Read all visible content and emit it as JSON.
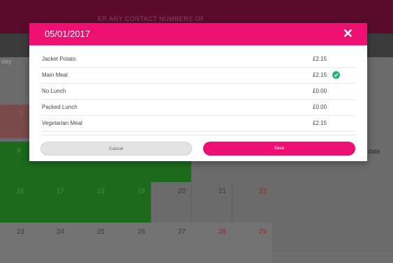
{
  "background": {
    "header_text": "ER ANY CONTACT NUMBERS OF",
    "day_label": "day",
    "date_label": "date",
    "side_number": "2",
    "calendar": [
      {
        "num": "9",
        "style": "green",
        "red": false
      },
      {
        "num": "",
        "style": "green",
        "red": false
      },
      {
        "num": "",
        "style": "green",
        "red": false
      },
      {
        "num": "",
        "style": "green",
        "red": false
      },
      {
        "num": "",
        "style": "green",
        "red": false
      },
      {
        "num": "16",
        "style": "green",
        "red": false
      },
      {
        "num": "17",
        "style": "green",
        "red": false
      },
      {
        "num": "18",
        "style": "green",
        "red": false
      },
      {
        "num": "19",
        "style": "green",
        "red": false
      },
      {
        "num": "20",
        "style": "gray",
        "red": false
      },
      {
        "num": "21",
        "style": "gray",
        "red": false
      },
      {
        "num": "22",
        "style": "gray",
        "red": true
      },
      {
        "num": "23",
        "style": "lightgray",
        "red": false
      },
      {
        "num": "24",
        "style": "lightgray",
        "red": false
      },
      {
        "num": "25",
        "style": "lightgray",
        "red": false
      },
      {
        "num": "26",
        "style": "lightgray",
        "red": false
      },
      {
        "num": "27",
        "style": "lightgray",
        "red": false
      },
      {
        "num": "28",
        "style": "lightgray",
        "red": true
      },
      {
        "num": "29",
        "style": "lightgray",
        "red": true
      }
    ]
  },
  "modal": {
    "title": "05/01/2017",
    "close_icon": "close-icon",
    "meals": [
      {
        "name": "Jacket Potato",
        "price": "£2.15",
        "selected": false
      },
      {
        "name": "Main Meal",
        "price": "£2.15",
        "selected": true
      },
      {
        "name": "No Lunch",
        "price": "£0.00",
        "selected": false
      },
      {
        "name": "Packed Lunch",
        "price": "£0.00",
        "selected": false
      },
      {
        "name": "Vegetarian Meal",
        "price": "£2.15",
        "selected": false
      }
    ],
    "cancel_label": "Cancel",
    "save_label": "Save"
  },
  "colors": {
    "accent": "#ee0f73",
    "selected_check": "#21b573",
    "calendar_green": "#1c6b1c"
  }
}
